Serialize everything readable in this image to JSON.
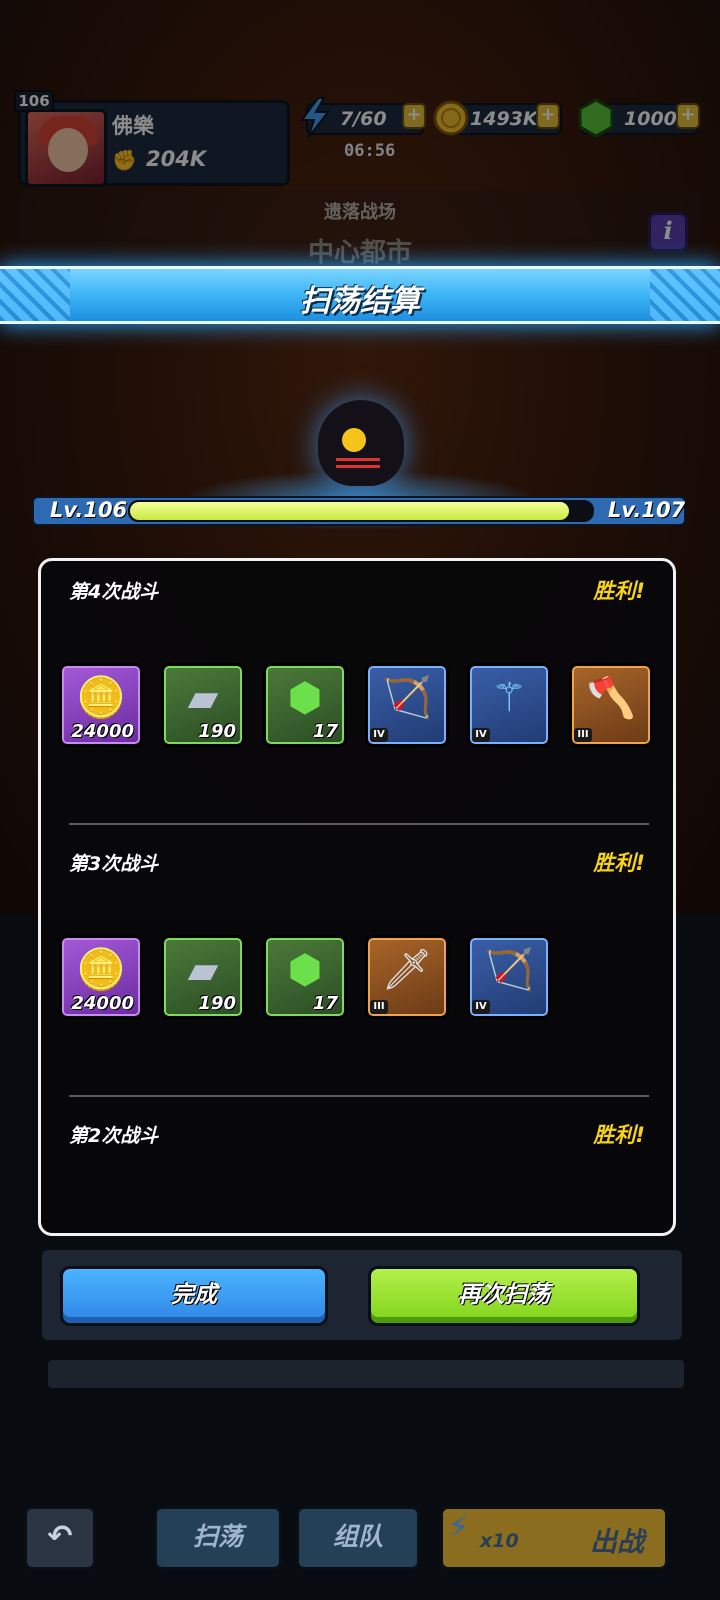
{
  "player": {
    "level": "106",
    "name": "佛樂",
    "power": "204K"
  },
  "resources": {
    "energy": "7/60",
    "energy_timer": "06:56",
    "gold": "1493K",
    "gems": "1000",
    "plus_label": "+"
  },
  "stage": {
    "mode": "遗落战场",
    "name": "中心都市"
  },
  "banner": {
    "title": "扫荡结算"
  },
  "level_bar": {
    "from": "Lv.106",
    "to": "Lv.107",
    "progress_pct": 95
  },
  "battles": [
    {
      "title": "第4次战斗",
      "result": "胜利!",
      "rewards": [
        {
          "icon": "gold-coins-icon",
          "rarity": "purple",
          "count": "24000"
        },
        {
          "icon": "silver-ingot-icon",
          "rarity": "green",
          "count": "190"
        },
        {
          "icon": "green-gem-icon",
          "rarity": "green",
          "count": "17"
        },
        {
          "icon": "crossbow-icon",
          "rarity": "blue",
          "tier": "IV"
        },
        {
          "icon": "staff-icon",
          "rarity": "blue",
          "tier": "IV"
        },
        {
          "icon": "axe-icon",
          "rarity": "orange",
          "tier": "III"
        }
      ]
    },
    {
      "title": "第3次战斗",
      "result": "胜利!",
      "rewards": [
        {
          "icon": "gold-coins-icon",
          "rarity": "purple",
          "count": "24000"
        },
        {
          "icon": "silver-ingot-icon",
          "rarity": "green",
          "count": "190"
        },
        {
          "icon": "green-gem-icon",
          "rarity": "green",
          "count": "17"
        },
        {
          "icon": "sword-icon",
          "rarity": "orange",
          "tier": "III"
        },
        {
          "icon": "crossbow-icon",
          "rarity": "blue",
          "tier": "IV"
        }
      ]
    },
    {
      "title": "第2次战斗",
      "result": "胜利!",
      "rewards": []
    }
  ],
  "buttons": {
    "done": "完成",
    "sweep_again": "再次扫荡"
  },
  "nav": {
    "sweep": "扫荡",
    "team": "组队",
    "cost": "x10",
    "battle": "出战"
  },
  "colors": {
    "accent_blue": "#3cb4f5",
    "victory_yellow": "#f6d31b",
    "sweep_green": "#7fd31a"
  }
}
